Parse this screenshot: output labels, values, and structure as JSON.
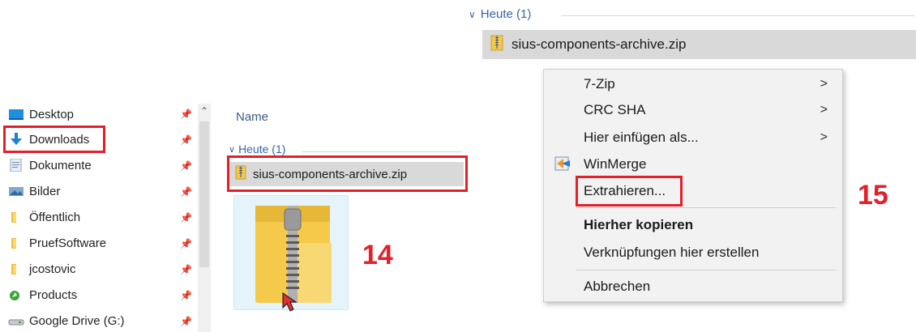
{
  "left_explorer": {
    "nav_items": [
      {
        "label": "Desktop",
        "icon": "desktop-icon"
      },
      {
        "label": "Downloads",
        "icon": "download-arrow-icon"
      },
      {
        "label": "Dokumente",
        "icon": "document-icon"
      },
      {
        "label": "Bilder",
        "icon": "pictures-icon"
      },
      {
        "label": "Öffentlich",
        "icon": "folder-icon"
      },
      {
        "label": "PruefSoftware",
        "icon": "folder-icon"
      },
      {
        "label": "jcostovic",
        "icon": "folder-icon"
      },
      {
        "label": "Products",
        "icon": "products-icon"
      },
      {
        "label": "Google Drive (G:)",
        "icon": "drive-icon"
      }
    ],
    "column_header": "Name",
    "group_header": "Heute (1)",
    "file_name": "sius-components-archive.zip",
    "step_label": "14"
  },
  "right_explorer": {
    "group_header": "Heute (1)",
    "file_name": "sius-components-archive.zip",
    "step_label": "15"
  },
  "context_menu": {
    "items": [
      {
        "label": "7-Zip",
        "submenu": true
      },
      {
        "label": "CRC SHA",
        "submenu": true
      },
      {
        "label": "Hier einfügen als...",
        "submenu": true
      },
      {
        "label": "WinMerge",
        "submenu": false
      },
      {
        "label": "Extrahieren...",
        "submenu": false
      },
      {
        "label": "Hierher kopieren",
        "submenu": false,
        "bold": true
      },
      {
        "label": "Verknüpfungen hier erstellen",
        "submenu": false
      },
      {
        "label": "Abbrechen",
        "submenu": false
      }
    ],
    "submenu_arrow": ">"
  },
  "colors": {
    "highlight": "#e3202a",
    "selection": "#d9d9d9",
    "link_blue": "#3a63a8"
  }
}
